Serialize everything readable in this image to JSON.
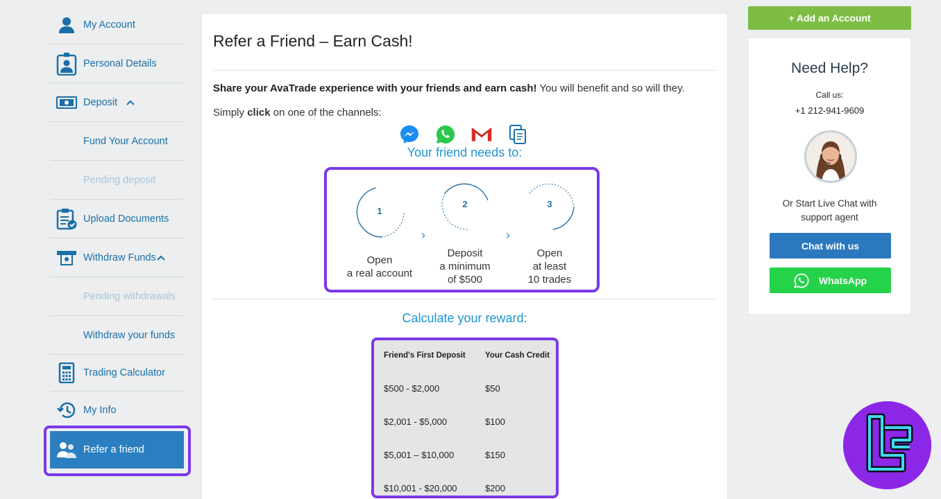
{
  "sidebar": {
    "items": [
      {
        "label": "My Account"
      },
      {
        "label": "Personal Details"
      },
      {
        "label": "Deposit"
      },
      {
        "label": "Fund Your Account"
      },
      {
        "label": "Pending deposit"
      },
      {
        "label": "Upload Documents"
      },
      {
        "label": "Withdraw Funds"
      },
      {
        "label": "Pending withdrawals"
      },
      {
        "label": "Withdraw your funds"
      },
      {
        "label": "Trading Calculator"
      },
      {
        "label": "My Info"
      },
      {
        "label": "Refer a friend"
      }
    ]
  },
  "main": {
    "title": "Refer a Friend – Earn Cash!",
    "intro_bold": "Share your AvaTrade experience with your friends and earn cash!",
    "intro_rest": " You will benefit and so will they.",
    "simply_pre": "Simply ",
    "simply_bold": "click",
    "simply_post": " on one of the channels:",
    "channels": [
      "messenger-icon",
      "whatsapp-icon",
      "gmail-icon",
      "copy-link-icon"
    ],
    "steps_title": "Your friend needs to:",
    "steps": [
      {
        "num": "1",
        "line1": "Open",
        "line2": "a real account",
        "line3": ""
      },
      {
        "num": "2",
        "line1": "Deposit",
        "line2": "a minimum",
        "line3": "of $500"
      },
      {
        "num": "3",
        "line1": "Open",
        "line2": "at least",
        "line3": "10 trades"
      }
    ],
    "reward_title": "Calculate your reward:",
    "reward_table": {
      "headers": [
        "Friend's First Deposit",
        "Your Cash Credit"
      ],
      "rows": [
        [
          "$500 - $2,000",
          "$50"
        ],
        [
          "$2,001 - $5,000",
          "$100"
        ],
        [
          "$5,001 – $10,000",
          "$150"
        ],
        [
          "$10,001 - $20,000",
          "$200"
        ]
      ]
    }
  },
  "right": {
    "add_account": "+ Add an Account",
    "help_title": "Need Help?",
    "call_us": "Call us:",
    "phone": "+1 212-941-9609",
    "live_chat_line1": "Or Start Live Chat with",
    "live_chat_line2": "support agent",
    "chat_button": "Chat with us",
    "whatsapp_button": "WhatsApp"
  },
  "colors": {
    "accent_blue": "#2b7fc1",
    "link_blue": "#1b6fa8",
    "highlight_purple": "#7b38e8",
    "add_green": "#7dbd45",
    "whatsapp_green": "#25d34a",
    "title_cyan": "#1c95d2"
  }
}
